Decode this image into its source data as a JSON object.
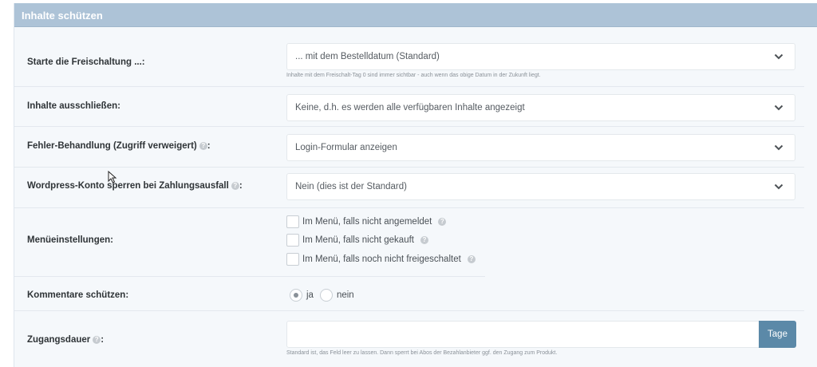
{
  "header": {
    "title": "Inhalte schützen"
  },
  "rows": {
    "start": {
      "label": "Starte die Freischaltung ...:",
      "value": "... mit dem Bestelldatum (Standard)",
      "hint": "Inhalte mit dem Freischalt-Tag 0 sind immer sichtbar - auch wenn das obige Datum in der Zukunft liegt."
    },
    "exclude": {
      "label": "Inhalte ausschließen:",
      "value": "Keine, d.h. es werden alle verfügbaren Inhalte angezeigt"
    },
    "error": {
      "label": "Fehler-Behandlung (Zugriff verweigert)",
      "label_suffix": " :",
      "value": "Login-Formular anzeigen"
    },
    "wp_account": {
      "label": "Wordpress-Konto sperren bei Zahlungsausfall",
      "label_suffix": " :",
      "value": "Nein (dies ist der Standard)"
    },
    "menu": {
      "label": "Menüeinstellungen:",
      "options": [
        "Im Menü, falls nicht angemeldet",
        "Im Menü, falls nicht gekauft",
        "Im Menü, falls noch nicht freigeschaltet"
      ]
    },
    "comments": {
      "label": "Kommentare schützen:",
      "options": [
        "ja",
        "nein"
      ],
      "selected": "ja"
    },
    "duration": {
      "label": "Zugangsdauer",
      "label_suffix": " :",
      "value": "",
      "addon": "Tage",
      "hint": "Standard ist, das Feld leer zu lassen. Dann sperrt bei Abos der Bezahlanbieter ggf. den Zugang zum Produkt."
    }
  },
  "icons": {
    "help": "question-circle-icon",
    "chevron": "chevron-down-icon"
  },
  "colors": {
    "header": "#adc3d7",
    "addon": "#5b89a8",
    "panel": "#f5f8fb"
  }
}
